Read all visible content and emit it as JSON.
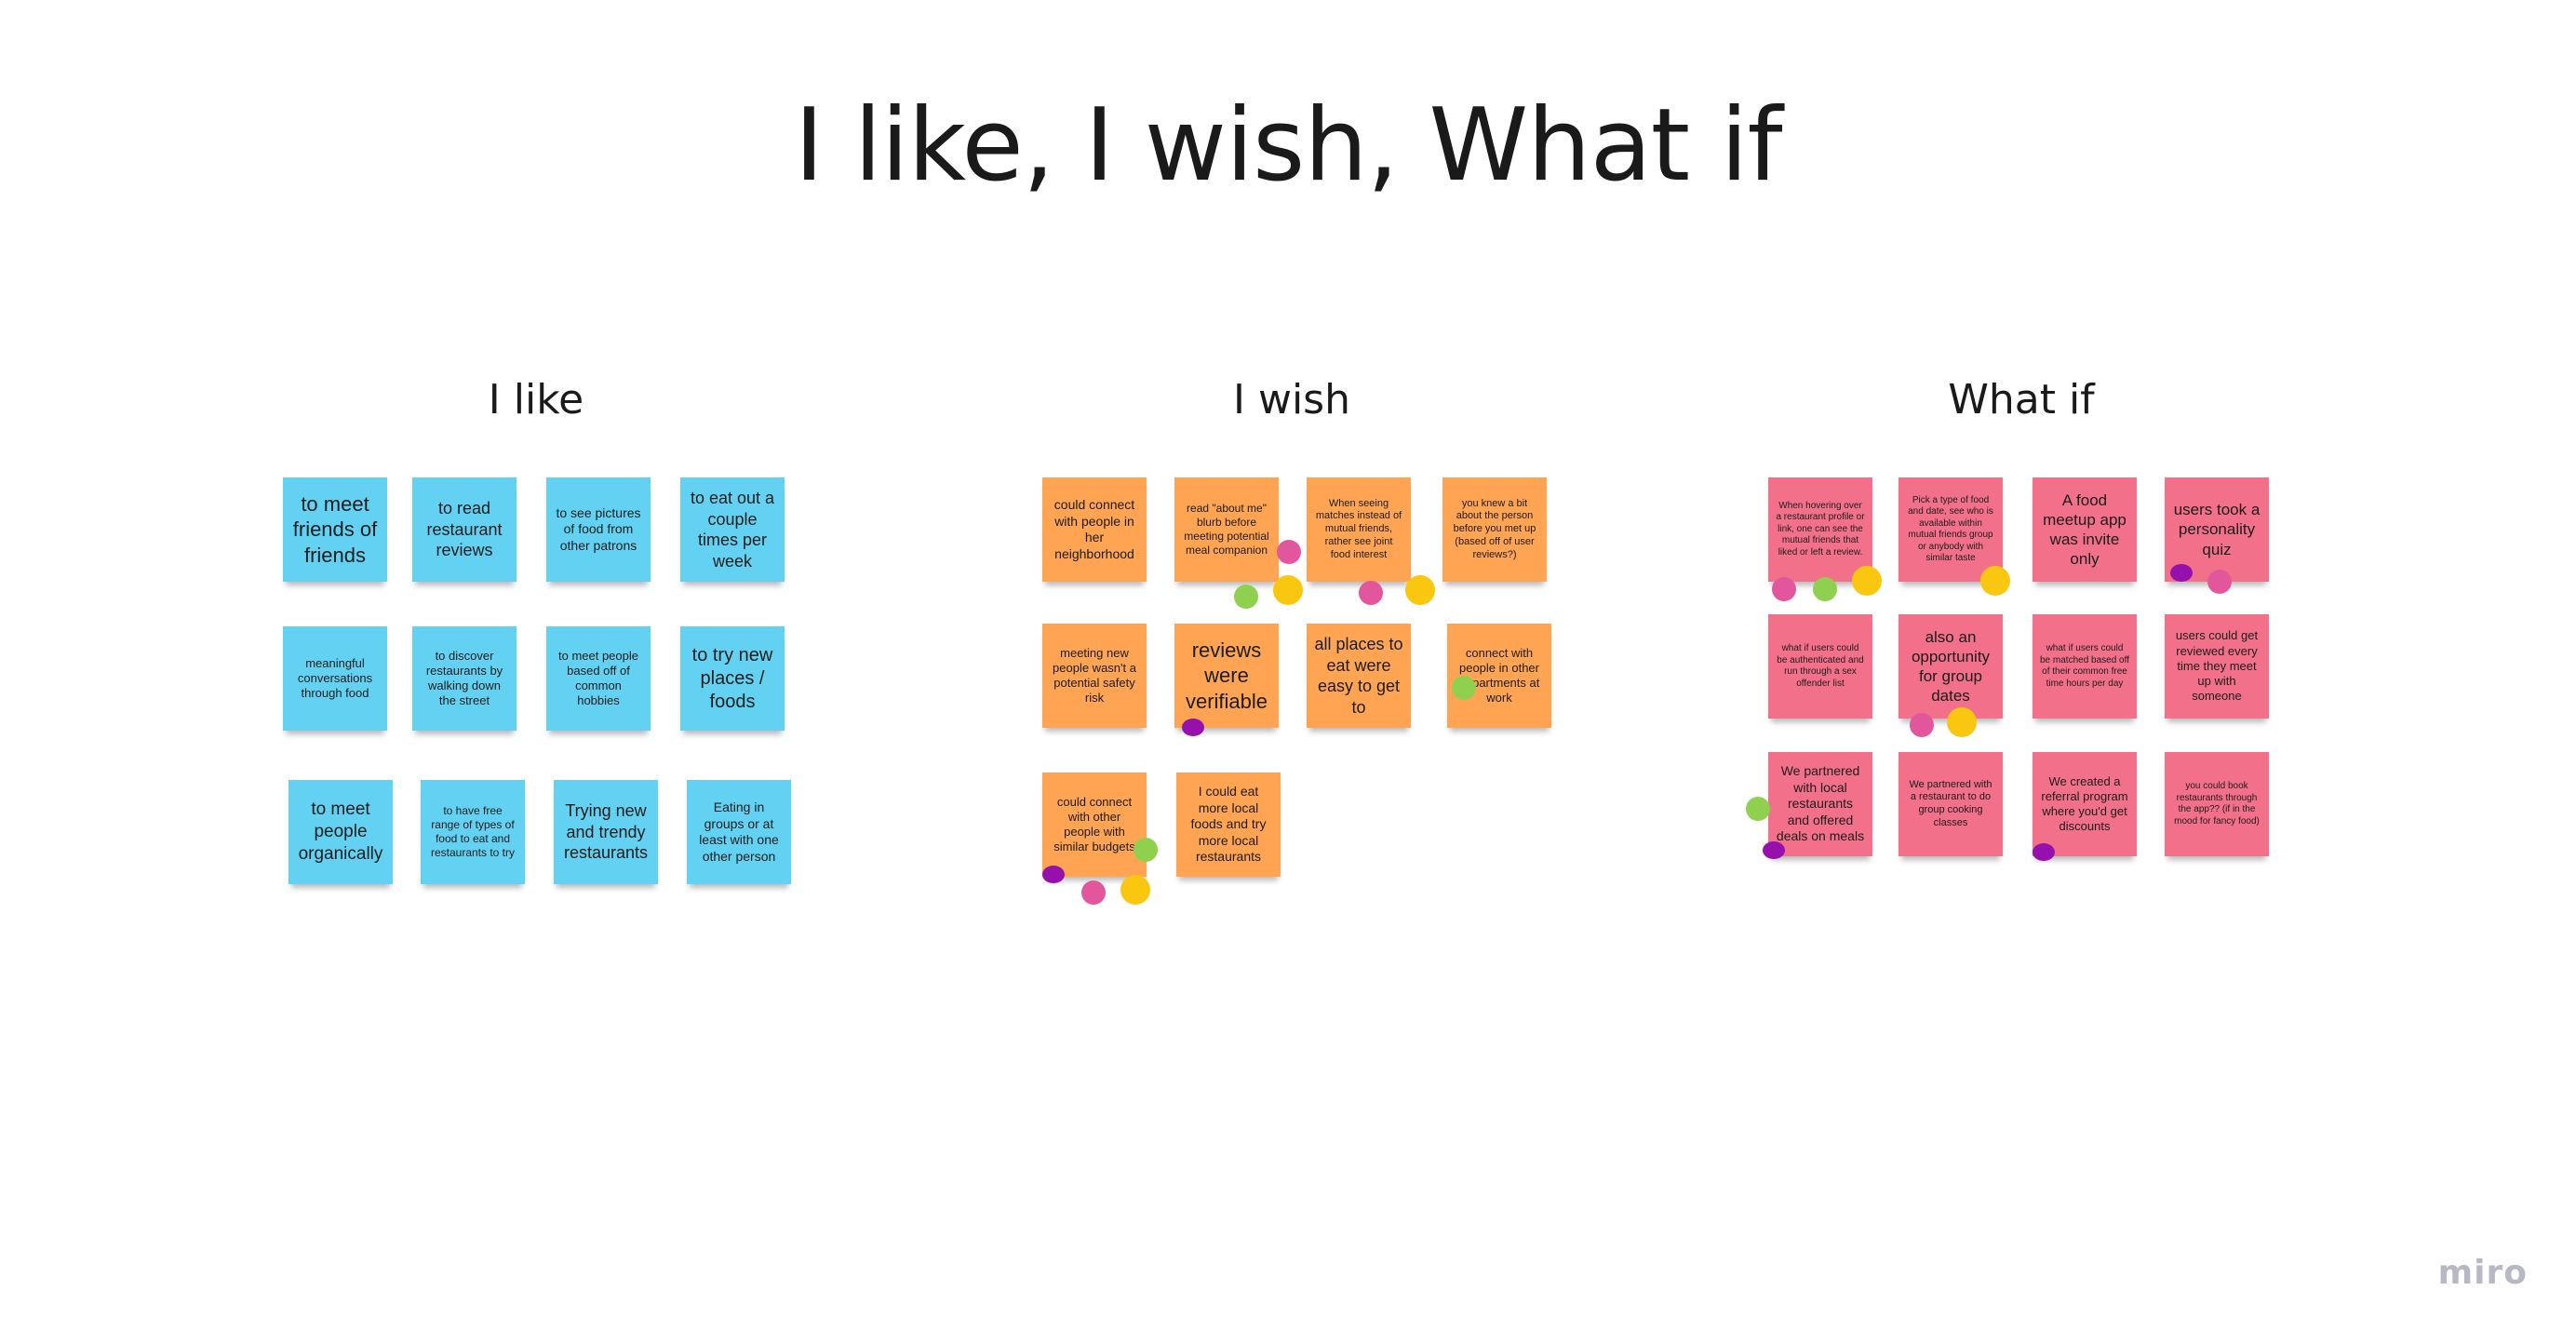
{
  "board": {
    "title": "I like, I wish, What if",
    "logo": "miro"
  },
  "columns": [
    {
      "heading": "I like",
      "color": "#63d2f2",
      "notes": [
        "to meet friends of friends",
        "to read restaurant reviews",
        "to see pictures of food from other patrons",
        "to eat out a couple times per week",
        "meaningful conversations through food",
        "to discover restaurants by walking down the street",
        "to meet people based off of common hobbies",
        "to try new places / foods",
        "to meet people organically",
        "to have free range of types of food to eat and restaurants to try",
        "Trying new and trendy restaurants",
        "Eating in groups or at least with one other person"
      ]
    },
    {
      "heading": "I wish",
      "color": "#fea452",
      "notes": [
        "could connect with people in her neighborhood",
        "read \"about me\" blurb before meeting potential meal companion",
        "When seeing matches instead of mutual friends, rather see joint food interest",
        "you knew a bit about the person before you met up (based off of user reviews?)",
        "meeting new people wasn't a potential safety risk",
        "reviews were verifiable",
        "all places to eat were easy to get to",
        "connect with people in other departments at work",
        "could connect with other people with similar budgets",
        "I could eat more local foods and try more local restaurants"
      ]
    },
    {
      "heading": "What if",
      "color": "#f2708a",
      "notes": [
        "When hovering over a restaurant profile or link, one can see the mutual friends that liked or left a review.",
        "Pick a type of food and date, see who is available within mutual friends group or anybody with similar taste",
        "A food meetup app was invite only",
        "users took a personality quiz",
        "what if users could be authenticated and run through a sex offender list",
        "also an opportunity for group dates",
        "what if users could be matched based off of their common free time hours per day",
        "users could get reviewed every time they meet up with someone",
        "We partnered with local restaurants and offered deals on meals",
        "We partnered with a restaurant to do group cooking classes",
        "We created a referral program where you'd get discounts",
        "you could book restaurants through the app?? (if in the mood for fancy food)"
      ]
    }
  ],
  "vote_colors": {
    "pink": "#e2579c",
    "green": "#8fd14f",
    "yellow": "#fac710",
    "purple": "#9510ac"
  }
}
